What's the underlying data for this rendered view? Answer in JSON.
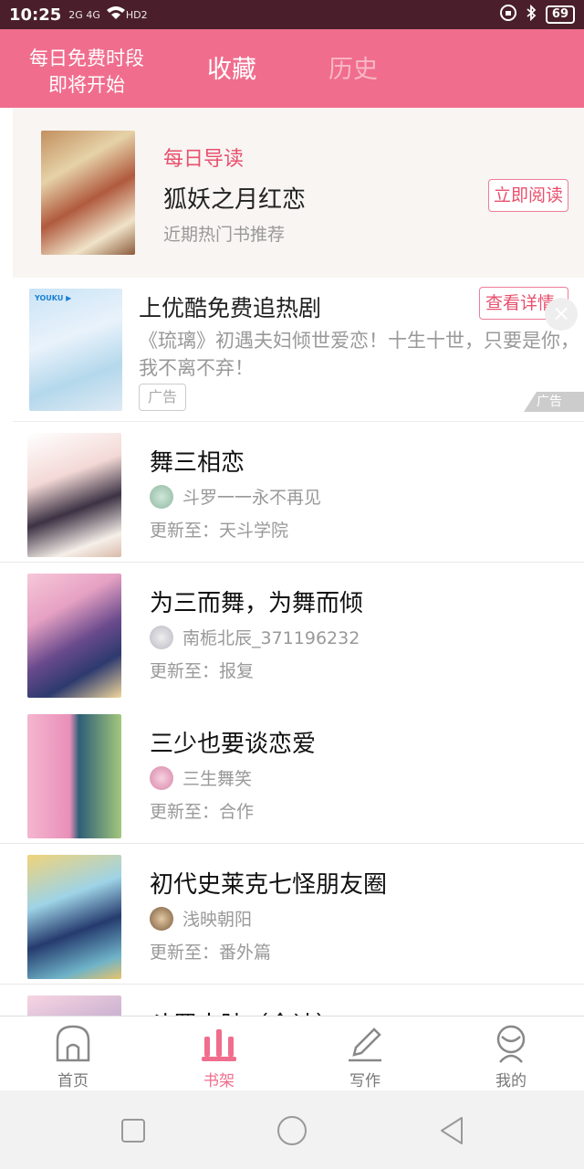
{
  "status": {
    "time": "10:25",
    "network": "2G 4G",
    "hd": "HD2",
    "battery": "69"
  },
  "header": {
    "free_line1": "每日免费时段",
    "free_line2": "即将开始",
    "tab_fav": "收藏",
    "tab_history": "历史"
  },
  "featured": {
    "tag": "每日导读",
    "title": "狐妖之月红恋",
    "subtitle": "近期热门书推荐",
    "button": "立即阅读"
  },
  "ad": {
    "logo": "YOUKU ▶",
    "title": "上优酷免费追热剧",
    "desc": "《琉璃》初遇夫妇倾世爱恋！十生十世，只要是你，我不离不弃！",
    "badge": "广告",
    "button": "查看详情",
    "close": "×",
    "mark": "广告"
  },
  "items": [
    {
      "title": "舞三相恋",
      "author": "斗罗一一永不再见",
      "update": "更新至：天斗学院"
    },
    {
      "title": "为三而舞，为舞而倾",
      "author": "南栀北辰_371196232",
      "update": "更新至：报复"
    },
    {
      "title": "三少也要谈恋爱",
      "author": "三生舞笑",
      "update": "更新至：合作"
    },
    {
      "title": "初代史莱克七怪朋友圈",
      "author": "浅映朝阳",
      "update": "更新至：番外篇"
    },
    {
      "title": "斗罗大陆（全诗）",
      "author": "",
      "update": ""
    }
  ],
  "tabbar": {
    "home": "首页",
    "shelf": "书架",
    "write": "写作",
    "mine": "我的"
  },
  "colors": {
    "accent": "#f06d8d",
    "status_bar": "#4a1f2b",
    "accent_text": "#e8506e"
  }
}
